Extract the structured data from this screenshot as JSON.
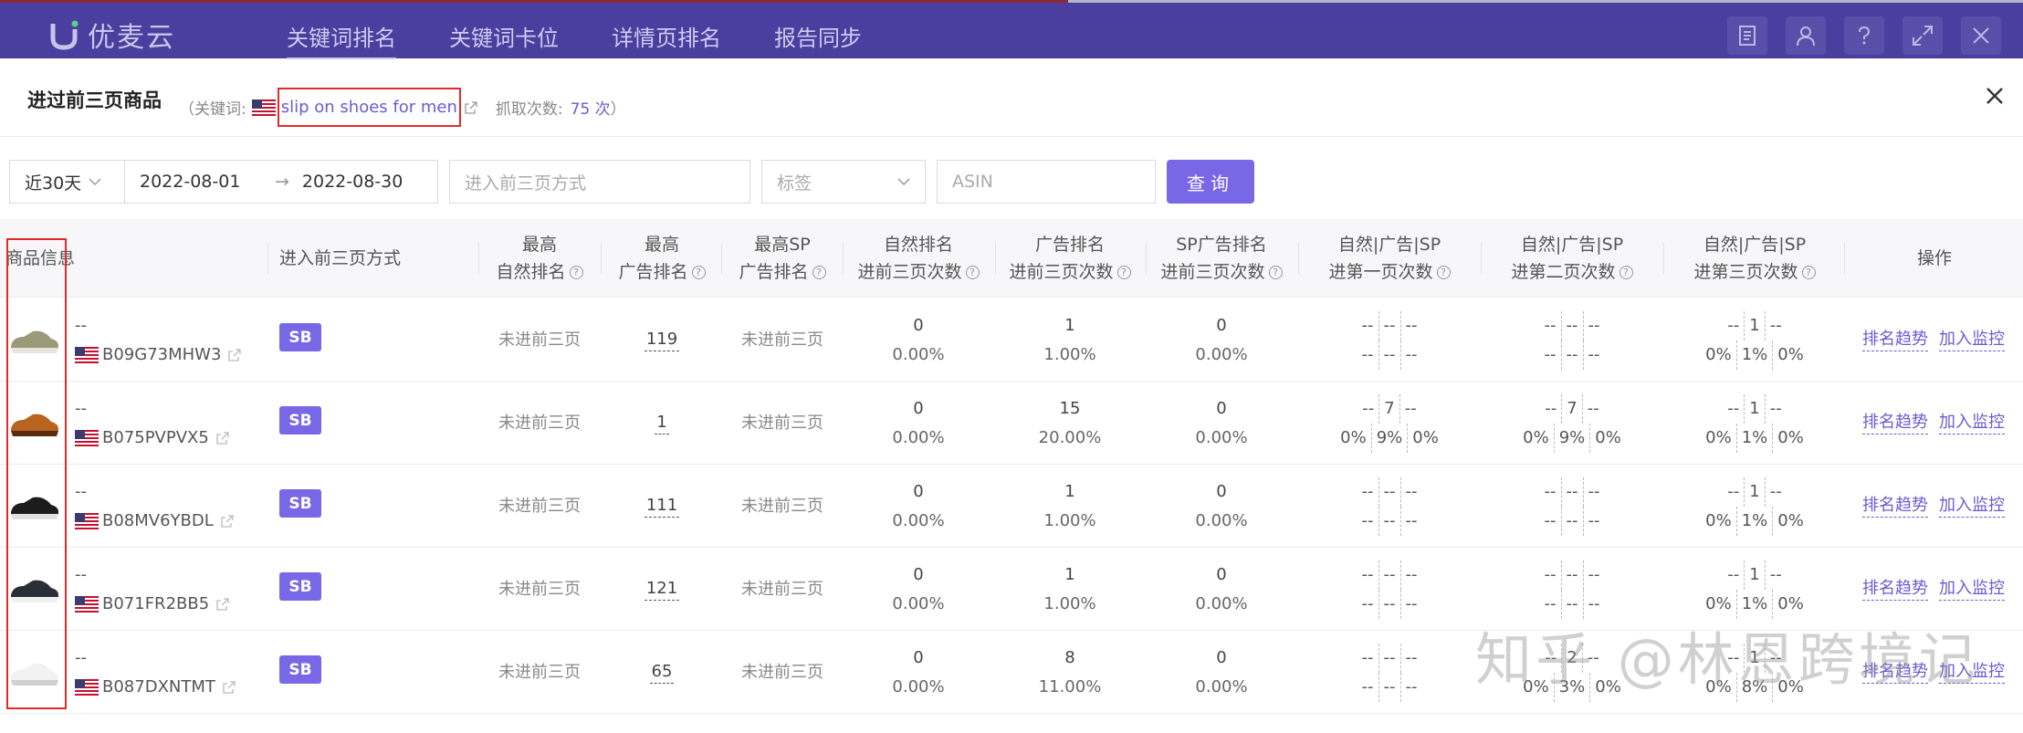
{
  "app": {
    "logo_text": "优麦云",
    "nav": [
      "关键词排名",
      "关键词卡位",
      "详情页排名",
      "报告同步"
    ],
    "active_nav": 0,
    "top_icons": [
      "document-icon",
      "user-icon",
      "help-icon",
      "fullscreen-icon",
      "close-icon"
    ]
  },
  "modal": {
    "title": "进过前三页商品",
    "keyword_label": "（关键词:",
    "keyword": "slip on shoes for men",
    "fetch_label": "抓取次数:",
    "fetch_count": "75 次",
    "fetch_close": "）"
  },
  "filters": {
    "preset": "近30天",
    "start_date": "2022-08-01",
    "end_date": "2022-08-30",
    "method_placeholder": "进入前三页方式",
    "tag_placeholder": "标签",
    "asin_placeholder": "ASIN",
    "query_label": "查询"
  },
  "table": {
    "headers": {
      "product": "商品信息",
      "method": "进入前三页方式",
      "best_natural": [
        "最高",
        "自然排名"
      ],
      "best_ad": [
        "最高",
        "广告排名"
      ],
      "best_sp": [
        "最高SP",
        "广告排名"
      ],
      "natural_top3": [
        "自然排名",
        "进前三页次数"
      ],
      "ad_top3": [
        "广告排名",
        "进前三页次数"
      ],
      "sp_top3": [
        "SP广告排名",
        "进前三页次数"
      ],
      "p1": [
        "自然|广告|SP",
        "进第一页次数"
      ],
      "p2": [
        "自然|广告|SP",
        "进第二页次数"
      ],
      "p3": [
        "自然|广告|SP",
        "进第三页次数"
      ],
      "ops": "操作"
    },
    "rows": [
      {
        "title": "--",
        "asin": "B09G73MHW3",
        "method": "SB",
        "best_natural": "未进前三页",
        "best_ad": "119",
        "best_sp": "未进前三页",
        "nat_cnt": "0",
        "nat_pct": "0.00%",
        "ad_cnt": "1",
        "ad_pct": "1.00%",
        "sp_cnt": "0",
        "sp_pct": "0.00%",
        "p1_top": [
          "--",
          "--",
          "--"
        ],
        "p1_bot": [
          "--",
          "--",
          "--"
        ],
        "p2_top": [
          "--",
          "--",
          "--"
        ],
        "p2_bot": [
          "--",
          "--",
          "--"
        ],
        "p3_top": [
          "--",
          "1",
          "--"
        ],
        "p3_bot": [
          "0%",
          "1%",
          "0%"
        ]
      },
      {
        "title": "--",
        "asin": "B075PVPVX5",
        "method": "SB",
        "best_natural": "未进前三页",
        "best_ad": "1",
        "best_sp": "未进前三页",
        "nat_cnt": "0",
        "nat_pct": "0.00%",
        "ad_cnt": "15",
        "ad_pct": "20.00%",
        "sp_cnt": "0",
        "sp_pct": "0.00%",
        "p1_top": [
          "--",
          "7",
          "--"
        ],
        "p1_bot": [
          "0%",
          "9%",
          "0%"
        ],
        "p2_top": [
          "--",
          "7",
          "--"
        ],
        "p2_bot": [
          "0%",
          "9%",
          "0%"
        ],
        "p3_top": [
          "--",
          "1",
          "--"
        ],
        "p3_bot": [
          "0%",
          "1%",
          "0%"
        ]
      },
      {
        "title": "--",
        "asin": "B08MV6YBDL",
        "method": "SB",
        "best_natural": "未进前三页",
        "best_ad": "111",
        "best_sp": "未进前三页",
        "nat_cnt": "0",
        "nat_pct": "0.00%",
        "ad_cnt": "1",
        "ad_pct": "1.00%",
        "sp_cnt": "0",
        "sp_pct": "0.00%",
        "p1_top": [
          "--",
          "--",
          "--"
        ],
        "p1_bot": [
          "--",
          "--",
          "--"
        ],
        "p2_top": [
          "--",
          "--",
          "--"
        ],
        "p2_bot": [
          "--",
          "--",
          "--"
        ],
        "p3_top": [
          "--",
          "1",
          "--"
        ],
        "p3_bot": [
          "0%",
          "1%",
          "0%"
        ]
      },
      {
        "title": "--",
        "asin": "B071FR2BB5",
        "method": "SB",
        "best_natural": "未进前三页",
        "best_ad": "121",
        "best_sp": "未进前三页",
        "nat_cnt": "0",
        "nat_pct": "0.00%",
        "ad_cnt": "1",
        "ad_pct": "1.00%",
        "sp_cnt": "0",
        "sp_pct": "0.00%",
        "p1_top": [
          "--",
          "--",
          "--"
        ],
        "p1_bot": [
          "--",
          "--",
          "--"
        ],
        "p2_top": [
          "--",
          "--",
          "--"
        ],
        "p2_bot": [
          "--",
          "--",
          "--"
        ],
        "p3_top": [
          "--",
          "1",
          "--"
        ],
        "p3_bot": [
          "0%",
          "1%",
          "0%"
        ]
      },
      {
        "title": "--",
        "asin": "B087DXNTMT",
        "method": "SB",
        "best_natural": "未进前三页",
        "best_ad": "65",
        "best_sp": "未进前三页",
        "nat_cnt": "0",
        "nat_pct": "0.00%",
        "ad_cnt": "8",
        "ad_pct": "11.00%",
        "sp_cnt": "0",
        "sp_pct": "0.00%",
        "p1_top": [
          "--",
          "--",
          "--"
        ],
        "p1_bot": [
          "--",
          "--",
          "--"
        ],
        "p2_top": [
          "--",
          "2",
          "--"
        ],
        "p2_bot": [
          "0%",
          "3%",
          "0%"
        ],
        "p3_top": [
          "--",
          "1",
          "--"
        ],
        "p3_bot": [
          "0%",
          "8%",
          "0%"
        ]
      }
    ],
    "op_trend": "排名趋势",
    "op_monitor": "加入监控"
  },
  "watermark": "知乎 @林恩跨境记",
  "colors": {
    "topbar": "#4a3f9f",
    "accent": "#7868e6",
    "link": "#6b5bd2",
    "highlight": "#e02a2a"
  }
}
